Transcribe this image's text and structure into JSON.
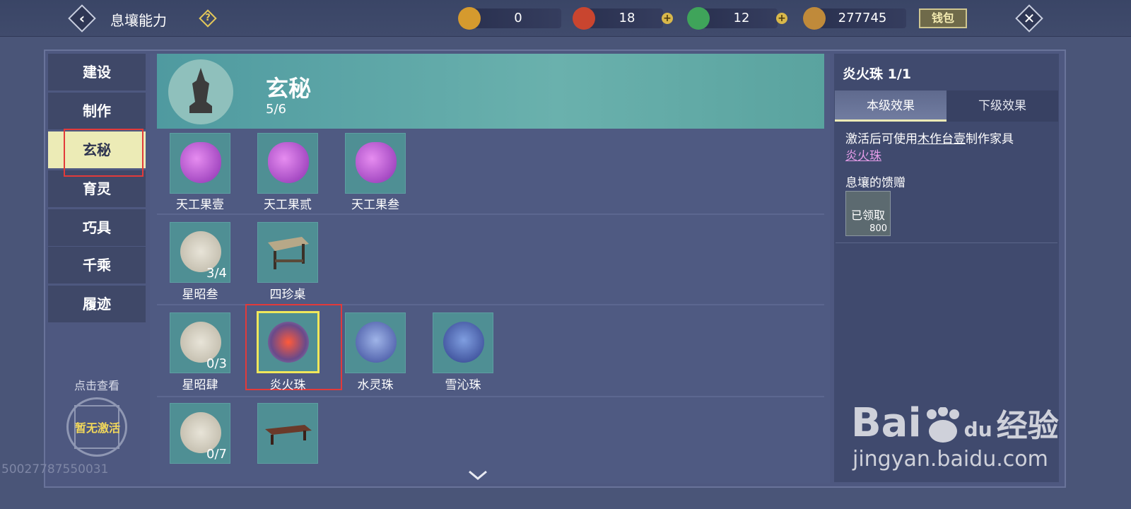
{
  "header": {
    "title": "息壤能力",
    "help_glyph": "?",
    "back_glyph": "‹",
    "close_glyph": "✕",
    "currencies": [
      {
        "name": "gold-token",
        "value": "0",
        "color": "#d59a2e",
        "plus": false
      },
      {
        "name": "red-jade",
        "value": "18",
        "color": "#c9452f",
        "plus": true
      },
      {
        "name": "green-jade",
        "value": "12",
        "color": "#3fa45a",
        "plus": true
      },
      {
        "name": "copper-coin",
        "value": "277745",
        "color": "#c08a3a",
        "plus": false
      }
    ],
    "plus_glyph": "+",
    "wallet_label": "钱包"
  },
  "sidebar": {
    "items": [
      {
        "label": "建设",
        "active": false
      },
      {
        "label": "制作",
        "active": false
      },
      {
        "label": "玄秘",
        "active": true
      },
      {
        "label": "育灵",
        "active": false
      },
      {
        "label": "巧具",
        "active": false
      },
      {
        "label": "千乘",
        "active": false
      },
      {
        "label": "履迹",
        "active": false
      }
    ],
    "hint": "点击查看",
    "seal_label": "暂无激活"
  },
  "uid": "50027787550031",
  "banner": {
    "title": "玄秘",
    "count": "5/6"
  },
  "items": [
    {
      "label": "天工果壹",
      "count": "",
      "icon": "purple-gem"
    },
    {
      "label": "天工果贰",
      "count": "",
      "icon": "purple-gem"
    },
    {
      "label": "天工果叁",
      "count": "",
      "icon": "purple-gem"
    },
    {
      "label": "星昭叁",
      "count": "3/4",
      "icon": "jade-disc"
    },
    {
      "label": "四珍桌",
      "count": "",
      "icon": "table"
    },
    {
      "label": "星昭肆",
      "count": "0/3",
      "icon": "jade-disc"
    },
    {
      "label": "炎火珠",
      "count": "",
      "icon": "fire-orb"
    },
    {
      "label": "水灵珠",
      "count": "",
      "icon": "water-orb"
    },
    {
      "label": "雪沁珠",
      "count": "",
      "icon": "snow-orb"
    },
    {
      "label": "",
      "count": "0/7",
      "icon": "jade-disc"
    },
    {
      "label": "",
      "count": "",
      "icon": "low-table"
    }
  ],
  "detail": {
    "title": "炎火珠 1/1",
    "tab_current": "本级效果",
    "tab_next": "下级效果",
    "desc_prefix": "激活后可使用",
    "desc_link": "木作台壹",
    "desc_suffix": "制作家具",
    "item_link": "炎火珠",
    "gift_title": "息壤的馈赠",
    "reward_status": "已领取",
    "reward_amount": "800"
  },
  "watermark": {
    "brand": "Bai",
    "brand_du": "du",
    "brand_cn": "经验",
    "url": "jingyan.baidu.com"
  },
  "colors": {
    "accent_active": "#ecebb6",
    "highlight_red": "#e23a3a",
    "highlight_yellow": "#f0e75a",
    "link_pink": "#e59ce8"
  }
}
